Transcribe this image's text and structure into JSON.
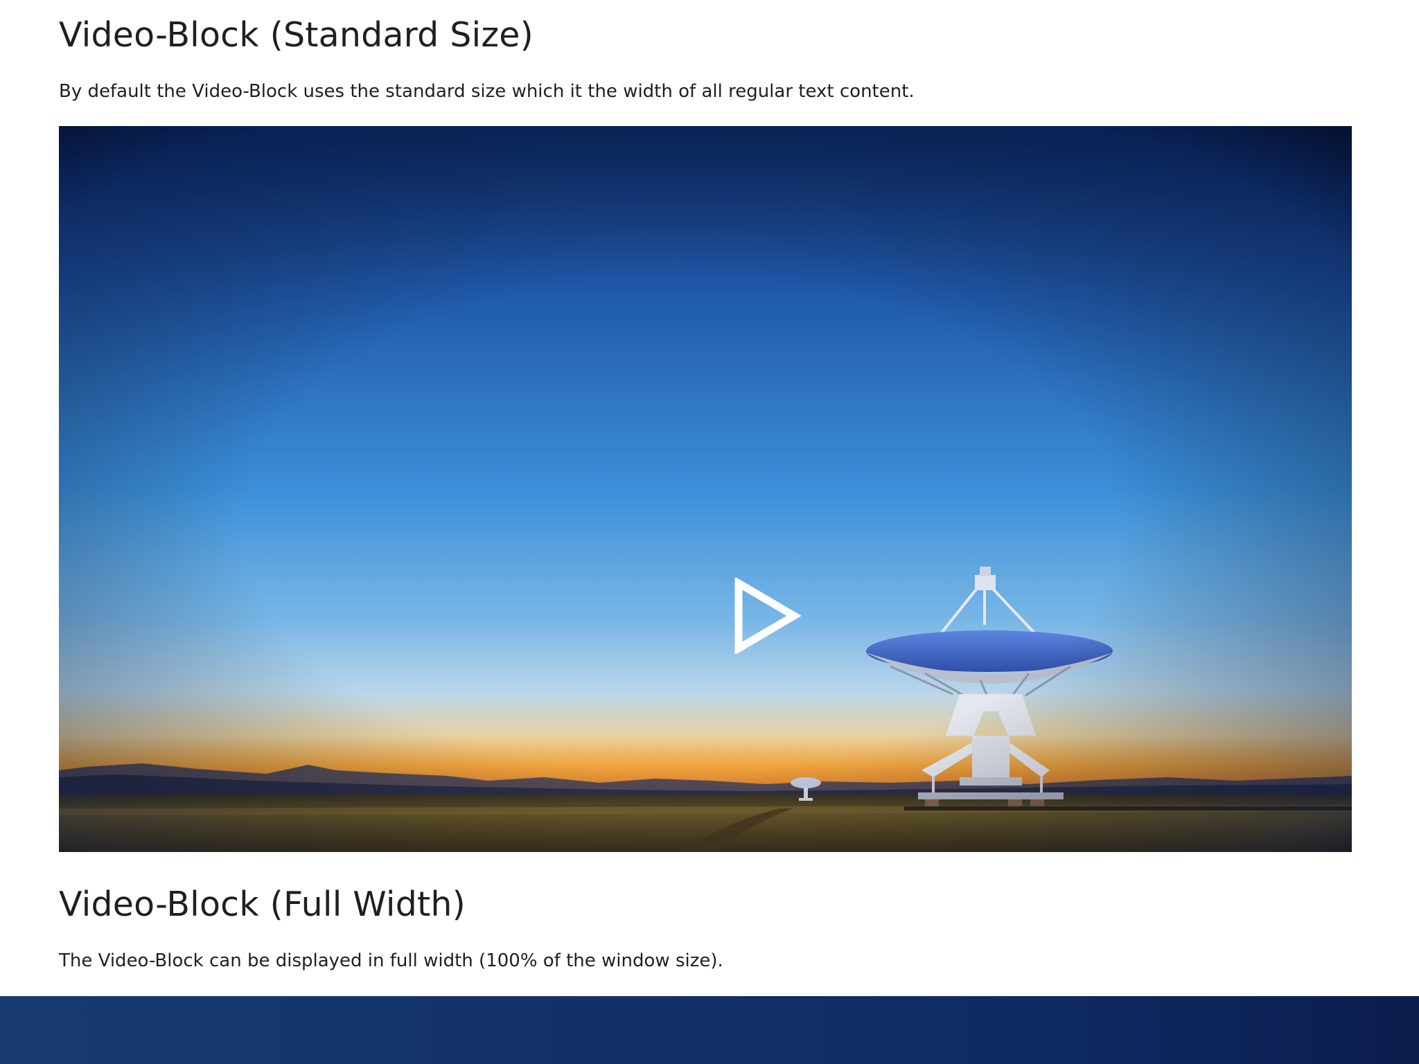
{
  "sections": [
    {
      "title": "Video-Block (Standard Size)",
      "description": "By default the Video-Block uses the standard size which it the width of all regular text content."
    },
    {
      "title": "Video-Block (Full Width)",
      "description": "The Video-Block can be displayed in full width (100% of the window size)."
    }
  ],
  "video_standard": {
    "play_icon": "play-icon",
    "poster_subject": "radio-telescope-dish"
  },
  "colors": {
    "text": "#1f1f1f",
    "sky_top": "#0d2a66",
    "sky_mid": "#3b8fd8",
    "horizon": "#f0a640",
    "ground": "#5a4a22",
    "play": "#ffffff"
  }
}
